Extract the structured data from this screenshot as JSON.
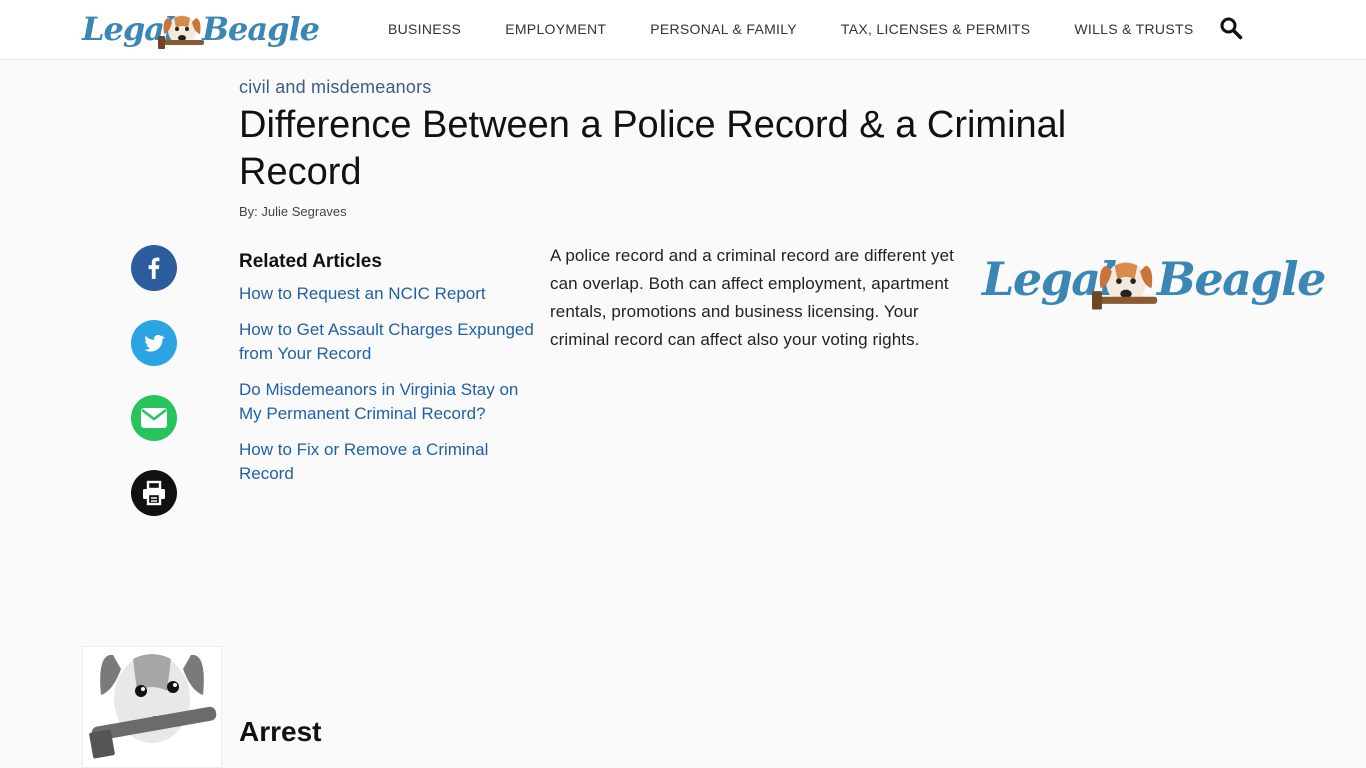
{
  "header": {
    "logo_left": "Legal",
    "logo_right": "Beagle",
    "nav": [
      "BUSINESS",
      "EMPLOYMENT",
      "PERSONAL & FAMILY",
      "TAX, LICENSES & PERMITS",
      "WILLS & TRUSTS"
    ]
  },
  "article": {
    "category": "civil and misdemeanors",
    "title": "Difference Between a Police Record & a Criminal Record",
    "byline": "By: Julie Segraves",
    "intro": "A police record and a criminal record are different yet can overlap. Both can affect employment, apartment rentals, promotions and business licensing. Your criminal record can affect also your voting rights."
  },
  "related": {
    "heading": "Related Articles",
    "links": [
      "How to Request an NCIC Report",
      "How to Get Assault Charges Expunged from Your Record",
      "Do Misdemeanors in Virginia Stay on My Permanent Criminal Record?",
      "How to Fix or Remove a Criminal Record"
    ]
  },
  "share": {
    "icons": [
      "facebook-icon",
      "twitter-icon",
      "email-icon",
      "print-icon"
    ],
    "colors": {
      "facebook": "#2b5c9e",
      "twitter": "#2aa4e2",
      "email": "#27c45b",
      "print": "#111111"
    }
  },
  "section": {
    "heading": "Arrest"
  },
  "colors": {
    "brand": "#3a87b5",
    "link": "#1f61a8",
    "category": "#3d5b87"
  }
}
